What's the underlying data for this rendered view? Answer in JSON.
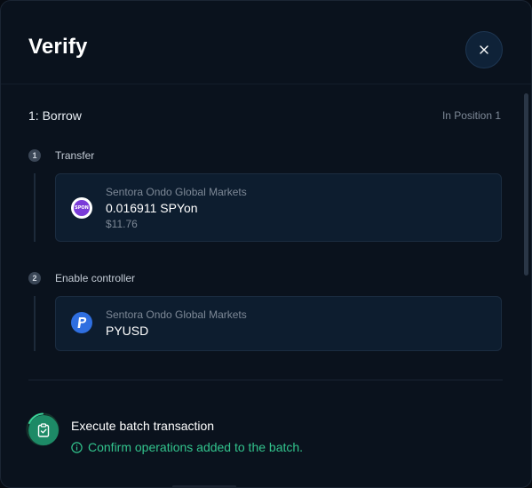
{
  "modal": {
    "title": "Verify",
    "close_icon": "close-icon"
  },
  "section": {
    "title": "1: Borrow",
    "meta": "In Position 1"
  },
  "steps": [
    {
      "number": "1",
      "label": "Transfer",
      "card": {
        "provider": "Sentora Ondo Global Markets",
        "amount": "0.016911 SPYon",
        "usd": "$11.76",
        "icon": "spyon-token-icon",
        "icon_text": "SPON",
        "icon_color": "#7a3bd8"
      }
    },
    {
      "number": "2",
      "label": "Enable controller",
      "card": {
        "provider": "Sentora Ondo Global Markets",
        "amount": "PYUSD",
        "icon": "pyusd-token-icon",
        "icon_color": "#2f6fe0"
      }
    }
  ],
  "execute": {
    "title": "Execute batch transaction",
    "info": "Confirm operations added to the batch.",
    "icon": "clipboard-check-icon",
    "info_icon": "info-icon",
    "accent_color": "#32c48d"
  }
}
